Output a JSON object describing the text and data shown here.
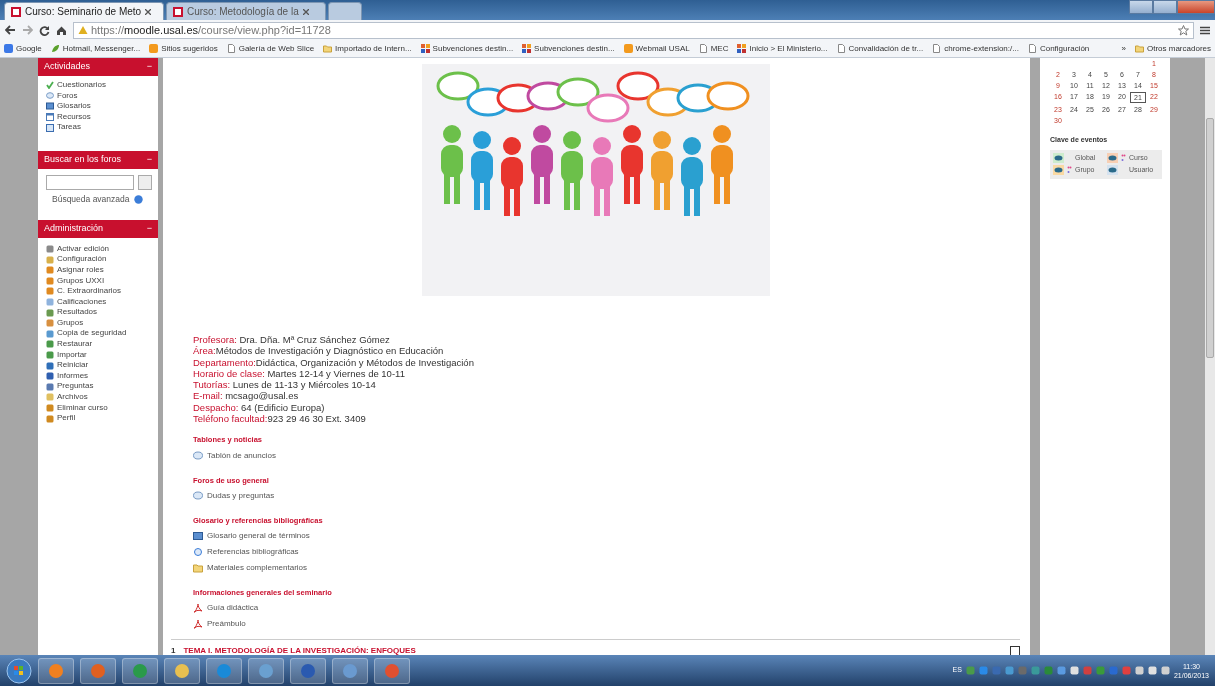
{
  "browser": {
    "tabs": [
      {
        "title": "Curso: Seminario de Meto",
        "selected": true
      },
      {
        "title": "Curso: Metodología de la",
        "selected": false
      }
    ],
    "url": {
      "scheme": "https://",
      "host": "moodle.usal.es",
      "path": "/course/view.php?id=11728"
    },
    "bookmarks": [
      {
        "label": "Google",
        "kind": "google"
      },
      {
        "label": "Hotmail, Messenger...",
        "kind": "leaf"
      },
      {
        "label": "Sitios sugeridos",
        "kind": "orange"
      },
      {
        "label": "Galería de Web Slice",
        "kind": "page"
      },
      {
        "label": "Importado de Intern...",
        "kind": "folder"
      },
      {
        "label": "Subvenciones destin...",
        "kind": "grid"
      },
      {
        "label": "Subvenciones destin...",
        "kind": "grid"
      },
      {
        "label": "Webmail USAL",
        "kind": "orange"
      },
      {
        "label": "MEC",
        "kind": "page"
      },
      {
        "label": "Inicio > El Ministerio...",
        "kind": "grid"
      },
      {
        "label": "Convalidación de tr...",
        "kind": "page"
      },
      {
        "label": "chrome-extension:/...",
        "kind": "page"
      },
      {
        "label": "Configuración",
        "kind": "page"
      }
    ],
    "overflow": "»",
    "other_bookmarks": "Otros marcadores"
  },
  "activities": {
    "title": "Actividades",
    "collapse": "−",
    "items": [
      {
        "label": "Cuestionarios",
        "kind": "check"
      },
      {
        "label": "Foros",
        "kind": "bubble"
      },
      {
        "label": "Glosarios",
        "kind": "book"
      },
      {
        "label": "Recursos",
        "kind": "window"
      },
      {
        "label": "Tareas",
        "kind": "doc"
      }
    ]
  },
  "forum_search": {
    "title": "Buscar en los foros",
    "collapse": "−",
    "advanced": "Búsqueda avanzada"
  },
  "administration": {
    "title": "Administración",
    "collapse": "−",
    "items": [
      "Activar edición",
      "Configuración",
      "Asignar roles",
      "Grupos UXXI",
      "C. Extraordinarios",
      "Calificaciones",
      "Resultados",
      "Grupos",
      "Copia de seguridad",
      "Restaurar",
      "Importar",
      "Reiniciar",
      "Informes",
      "Preguntas",
      "Archivos",
      "Eliminar curso",
      "Perfil"
    ]
  },
  "teacher_info": [
    {
      "label": "Profesora:",
      "value": " Dra. Dña. Mª Cruz Sánchez Gómez"
    },
    {
      "label": "Área:",
      "value": "Métodos de Investigación y Diagnóstico en Educación"
    },
    {
      "label": "Departamento:",
      "value": "Didáctica, Organización y Métodos de Investigación"
    },
    {
      "label": "Horario de clase:",
      "value": " Martes 12-14 y Viernes de 10-11"
    },
    {
      "label": "Tutorías:",
      "value": " Lunes de 11-13 y Miércoles 10-14"
    },
    {
      "label": "E-mail:",
      "value": " mcsago@usal.es"
    },
    {
      "label": "Despacho:",
      "value": " 64 (Edificio Europa)"
    },
    {
      "label": "Teléfono facultad:",
      "value": "923 29 46 30 Ext. 3409"
    }
  ],
  "sections": [
    {
      "heading": "Tablones y noticias",
      "items": [
        {
          "label": "Tablón de anuncios",
          "kind": "forum"
        }
      ]
    },
    {
      "heading": "Foros de uso general",
      "items": [
        {
          "label": "Dudas y preguntas",
          "kind": "forum"
        }
      ]
    },
    {
      "heading": "Glosario y referencias bibliográficas",
      "items": [
        {
          "label": "Glosario general de términos",
          "kind": "glossary"
        },
        {
          "label": "Referencias bibliográficas",
          "kind": "url"
        },
        {
          "label": "Materiales complementarios",
          "kind": "folder"
        }
      ]
    },
    {
      "heading": "Informaciones generales del seminario",
      "items": [
        {
          "label": "Guía didáctica",
          "kind": "pdf"
        },
        {
          "label": "Preámbulo",
          "kind": "pdf"
        }
      ]
    }
  ],
  "topic": {
    "number": "1",
    "title": "TEMA I. METODOLOGÍA DE LA INVESTIGACIÓN: ENFOQUES",
    "checked": false
  },
  "calendar": {
    "weeks": [
      {
        "days": [
          {
            "day": "1",
            "weekend": true,
            "today": false
          }
        ]
      },
      {
        "days": [
          {
            "day": "2",
            "weekend": true,
            "today": false
          },
          {
            "day": "3",
            "weekend": false,
            "today": false
          },
          {
            "day": "4",
            "weekend": false,
            "today": false
          },
          {
            "day": "5",
            "weekend": false,
            "today": false
          },
          {
            "day": "6",
            "weekend": false,
            "today": false
          },
          {
            "day": "7",
            "weekend": false,
            "today": false
          },
          {
            "day": "8",
            "weekend": true,
            "today": false
          }
        ]
      },
      {
        "days": [
          {
            "day": "9",
            "weekend": true,
            "today": false
          },
          {
            "day": "10",
            "weekend": false,
            "today": false
          },
          {
            "day": "11",
            "weekend": false,
            "today": false
          },
          {
            "day": "12",
            "weekend": false,
            "today": false
          },
          {
            "day": "13",
            "weekend": false,
            "today": false
          },
          {
            "day": "14",
            "weekend": false,
            "today": false
          },
          {
            "day": "15",
            "weekend": true,
            "today": false
          }
        ]
      },
      {
        "days": [
          {
            "day": "16",
            "weekend": true,
            "today": false
          },
          {
            "day": "17",
            "weekend": false,
            "today": false
          },
          {
            "day": "18",
            "weekend": false,
            "today": false
          },
          {
            "day": "19",
            "weekend": false,
            "today": false
          },
          {
            "day": "20",
            "weekend": false,
            "today": false
          },
          {
            "day": "21",
            "weekend": false,
            "today": true
          },
          {
            "day": "22",
            "weekend": true,
            "today": false
          }
        ]
      },
      {
        "days": [
          {
            "day": "23",
            "weekend": true,
            "today": false
          },
          {
            "day": "24",
            "weekend": false,
            "today": false
          },
          {
            "day": "25",
            "weekend": false,
            "today": false
          },
          {
            "day": "26",
            "weekend": false,
            "today": false
          },
          {
            "day": "27",
            "weekend": false,
            "today": false
          },
          {
            "day": "28",
            "weekend": false,
            "today": false
          },
          {
            "day": "29",
            "weekend": true,
            "today": false
          }
        ]
      },
      {
        "days": [
          {
            "day": "30",
            "weekend": true,
            "today": false
          }
        ]
      }
    ],
    "legend_title": "Clave de eventos",
    "legend": [
      {
        "label": "Global",
        "color": "#cdeccd",
        "dots": false
      },
      {
        "label": "Curso",
        "color": "#f7cfb4",
        "dots": true
      },
      {
        "label": "Grupo",
        "color": "#f9d9a3",
        "dots": true
      },
      {
        "label": "Usuario",
        "color": "#d5e2ef",
        "dots": false
      }
    ]
  },
  "taskbar": {
    "language": "ES",
    "time": "11:30",
    "date": "21/06/2013"
  }
}
